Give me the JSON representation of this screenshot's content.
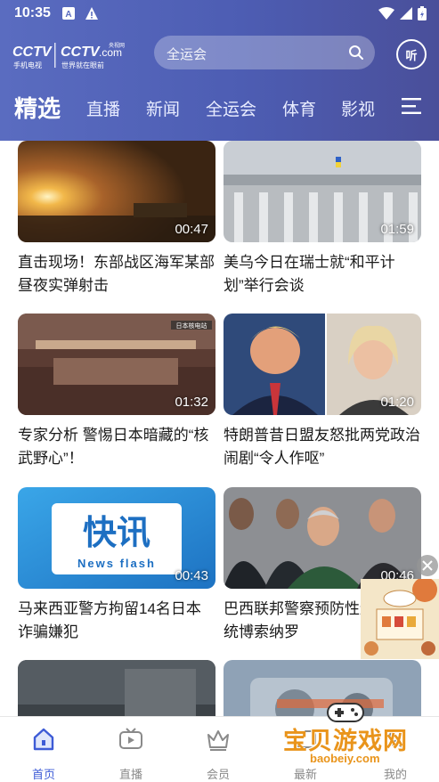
{
  "status_bar": {
    "time": "10:35"
  },
  "header": {
    "logo_alt": "CCTV 手机电视 CCTV.com 央视网 世界就在眼前",
    "search_placeholder": "全运会",
    "listen_label": "听"
  },
  "tabs": [
    {
      "label": "精选",
      "active": true
    },
    {
      "label": "直播"
    },
    {
      "label": "新闻"
    },
    {
      "label": "全运会"
    },
    {
      "label": "体育"
    },
    {
      "label": "影视"
    }
  ],
  "feed": [
    {
      "title": "直击现场！东部战区海军某部昼夜实弹射击",
      "duration": "00:47",
      "thumb_icon": "night-fire-thumbnail"
    },
    {
      "title": "美乌今日在瑞士就“和平计划”举行会谈",
      "duration": "01:59",
      "thumb_icon": "government-building-thumbnail"
    },
    {
      "title": "专家分析 警惕日本暗藏的“核武野心”！",
      "duration": "01:32",
      "thumb_icon": "nuclear-plant-interior-thumbnail",
      "overlay_text": "日本核电站"
    },
    {
      "title": "特朗普昔日盟友怒批两党政治闹剧“令人作呕”",
      "duration": "01:20",
      "thumb_icon": "politicians-portrait-thumbnail"
    },
    {
      "title": "马来西亚警方拘留14名日本诈骗嫌犯",
      "duration": "00:43",
      "thumb_icon": "news-flash-thumbnail",
      "overlay_title": "快讯",
      "overlay_sub": "News flash"
    },
    {
      "title": "巴西联邦警察预防性逮捕前总统博索纳罗",
      "duration": "00:46",
      "thumb_icon": "arrest-crowd-thumbnail"
    },
    {
      "title": "",
      "duration": "",
      "thumb_icon": "road-scene-thumbnail"
    },
    {
      "title": "",
      "duration": "",
      "thumb_icon": "machinery-thumbnail"
    }
  ],
  "bottom_nav": [
    {
      "label": "首页",
      "icon": "home-icon",
      "active": true
    },
    {
      "label": "直播",
      "icon": "tv-icon"
    },
    {
      "label": "会员",
      "icon": "crown-icon"
    },
    {
      "label": "最新",
      "icon": "new-icon"
    },
    {
      "label": "我的",
      "icon": "profile-icon"
    }
  ],
  "watermark": {
    "main": "宝贝游戏网",
    "sub": "baobeiy.com"
  },
  "colors": {
    "header": "#5a6cc0",
    "accent": "#3d5bd6",
    "watermark": "#e9941b"
  }
}
